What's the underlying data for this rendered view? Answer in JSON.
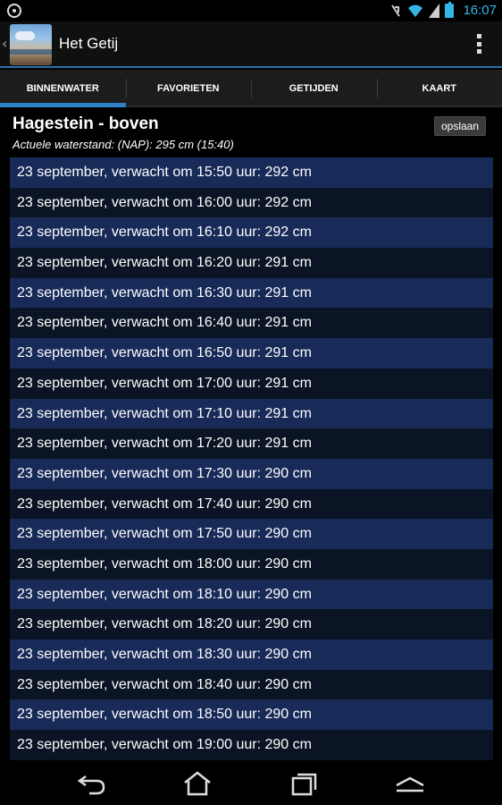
{
  "status_bar": {
    "time": "16:07",
    "icons": [
      "sync-icon",
      "mute-icon",
      "wifi-icon",
      "signal-icon",
      "battery-icon"
    ],
    "accent_color": "#33b5e5"
  },
  "action_bar": {
    "title": "Het Getij",
    "icons": [
      "up-caret-icon",
      "app-icon",
      "overflow-menu-icon"
    ]
  },
  "tabs": [
    {
      "label": "BINNENWATER",
      "active": true
    },
    {
      "label": "FAVORIETEN",
      "active": false
    },
    {
      "label": "GETIJDEN",
      "active": false
    },
    {
      "label": "KAART",
      "active": false
    }
  ],
  "station": {
    "name": "Hagestein - boven",
    "current_level": "Actuele waterstand: (NAP): 295 cm (15:40)",
    "save_label": "opslaan"
  },
  "forecast": [
    "23 september, verwacht om 15:50 uur: 292 cm",
    "23 september, verwacht om 16:00 uur: 292 cm",
    "23 september, verwacht om 16:10 uur: 292 cm",
    "23 september, verwacht om 16:20 uur: 291 cm",
    "23 september, verwacht om 16:30 uur: 291 cm",
    "23 september, verwacht om 16:40 uur: 291 cm",
    "23 september, verwacht om 16:50 uur: 291 cm",
    "23 september, verwacht om 17:00 uur: 291 cm",
    "23 september, verwacht om 17:10 uur: 291 cm",
    "23 september, verwacht om 17:20 uur: 291 cm",
    "23 september, verwacht om 17:30 uur: 290 cm",
    "23 september, verwacht om 17:40 uur: 290 cm",
    "23 september, verwacht om 17:50 uur: 290 cm",
    "23 september, verwacht om 18:00 uur: 290 cm",
    "23 september, verwacht om 18:10 uur: 290 cm",
    "23 september, verwacht om 18:20 uur: 290 cm",
    "23 september, verwacht om 18:30 uur: 290 cm",
    "23 september, verwacht om 18:40 uur: 290 cm",
    "23 september, verwacht om 18:50 uur: 290 cm",
    "23 september, verwacht om 19:00 uur: 290 cm"
  ],
  "colors": {
    "row_odd": "#182a58",
    "row_even": "#0b1424",
    "tab_indicator": "#2f81c7"
  },
  "nav_bar": {
    "icons": [
      "back-icon",
      "home-icon",
      "recent-apps-icon",
      "menu-icon"
    ]
  }
}
